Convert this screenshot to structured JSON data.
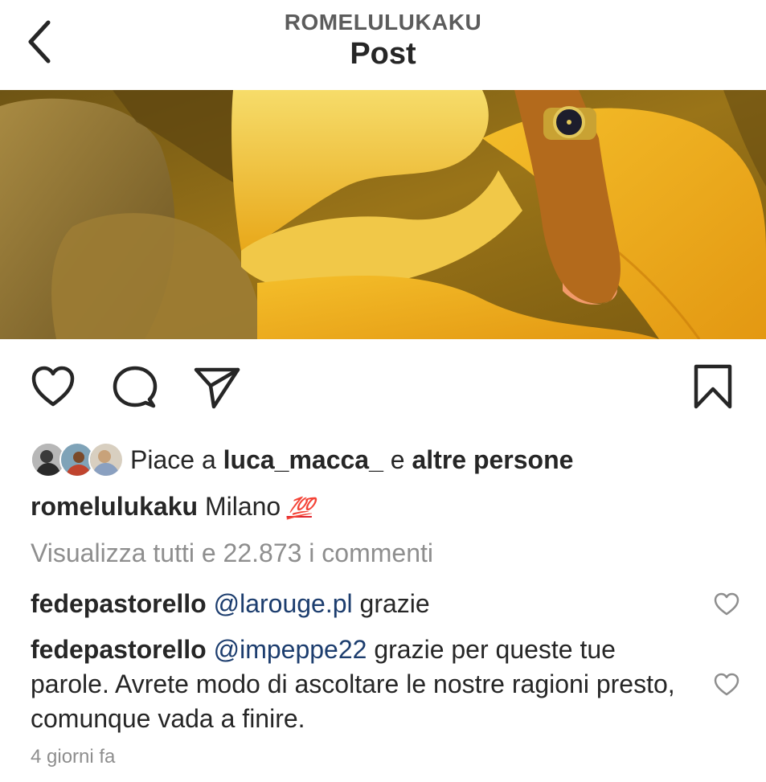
{
  "header": {
    "username": "ROMELULUKAKU",
    "title": "Post",
    "back_icon": "chevron-left-icon"
  },
  "actions": {
    "like_icon": "heart-outline-icon",
    "comment_icon": "comment-bubble-icon",
    "share_icon": "paper-plane-icon",
    "save_icon": "bookmark-icon"
  },
  "likes": {
    "prefix": "Piace a",
    "user": "luca_macca_",
    "connector": "e",
    "others": "altre persone"
  },
  "caption": {
    "username": "romelulukaku",
    "text": "Milano",
    "emoji": "💯"
  },
  "view_all_comments": "Visualizza tutti e 22.873 i commenti",
  "comments": [
    {
      "username": "fedepastorello",
      "mention": "@larouge.pl",
      "text": "grazie"
    },
    {
      "username": "fedepastorello",
      "mention": "@impeppe22",
      "text": "grazie per queste tue parole. Avrete modo di ascoltare le nostre ragioni presto, comunque vada a finire."
    }
  ],
  "timestamp": "4 giorni fa",
  "colors": {
    "text": "#262626",
    "secondary_text": "#8e8e8e",
    "mention": "#1c3d6e",
    "emoji_red": "#e0242e"
  }
}
